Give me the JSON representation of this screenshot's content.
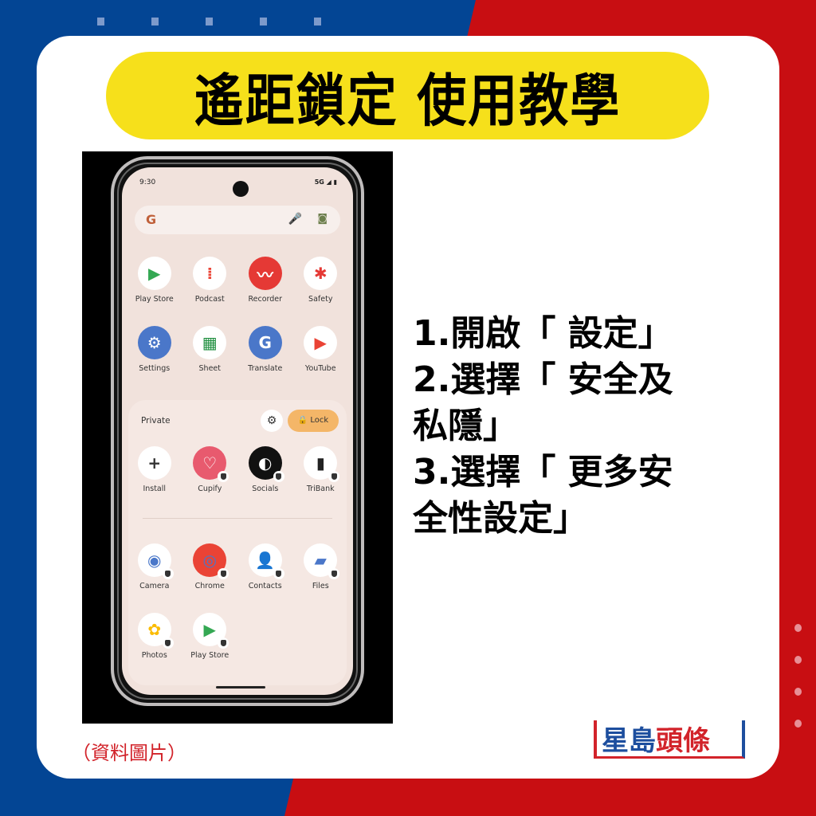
{
  "title": "遙距鎖定  使用教學",
  "phone": {
    "status_time": "9:30",
    "status_signal": "5G ◢ ▮",
    "search": {
      "logo": "G",
      "mic_icon": "mic-icon",
      "lens_icon": "lens-icon"
    },
    "apps_row1": [
      {
        "label": "Play Store",
        "icon": "▶",
        "color": "#34a853"
      },
      {
        "label": "Podcast",
        "icon": "⁞",
        "color": "#ea4335"
      },
      {
        "label": "Recorder",
        "icon": "〰",
        "color": "#ffffff",
        "bg": "#e53935"
      },
      {
        "label": "Safety",
        "icon": "✱",
        "color": "#e53935"
      }
    ],
    "apps_row2": [
      {
        "label": "Settings",
        "icon": "⚙",
        "color": "#ffffff",
        "bg": "#4a77c9"
      },
      {
        "label": "Sheet",
        "icon": "▦",
        "color": "#1e8e3e"
      },
      {
        "label": "Translate",
        "icon": "G",
        "color": "#ffffff",
        "bg": "#4a77c9"
      },
      {
        "label": "YouTube",
        "icon": "▶",
        "color": "#ea4335"
      }
    ],
    "private": {
      "title": "Private",
      "lock_label": "🔒 Lock",
      "apps_row1": [
        {
          "label": "Install",
          "icon": "+",
          "color": "#333333",
          "badge": false
        },
        {
          "label": "Cupify",
          "icon": "♡",
          "color": "#ffffff",
          "bg": "#e85a6e",
          "badge": true
        },
        {
          "label": "Socials",
          "icon": "◐",
          "color": "#ffffff",
          "bg": "#111111",
          "badge": true
        },
        {
          "label": "TriBank",
          "icon": "▮",
          "color": "#222222",
          "badge": true
        }
      ],
      "apps_row2": [
        {
          "label": "Camera",
          "icon": "◉",
          "color": "#4a77c9",
          "badge": true
        },
        {
          "label": "Chrome",
          "icon": "◎",
          "color": "#4a77c9",
          "bg": "#ea4335",
          "badge": true
        },
        {
          "label": "Contacts",
          "icon": "👤",
          "color": "#4a77c9",
          "badge": true
        },
        {
          "label": "Files",
          "icon": "▰",
          "color": "#4a77c9",
          "badge": true
        }
      ],
      "apps_row3": [
        {
          "label": "Photos",
          "icon": "✿",
          "color": "#fbbc04",
          "badge": true
        },
        {
          "label": "Play Store",
          "icon": "▶",
          "color": "#34a853",
          "badge": true
        }
      ]
    }
  },
  "steps": [
    "1.開啟「 設定」",
    "2.選擇「 安全及",
    "私隱」",
    "3.選擇「 更多安",
    "全性設定」"
  ],
  "caption": "（資料圖片）",
  "logo": {
    "part1": "星島",
    "part2": "頭條"
  },
  "colors": {
    "blue": "#034594",
    "red": "#c80e12",
    "yellow": "#f6e01b"
  }
}
